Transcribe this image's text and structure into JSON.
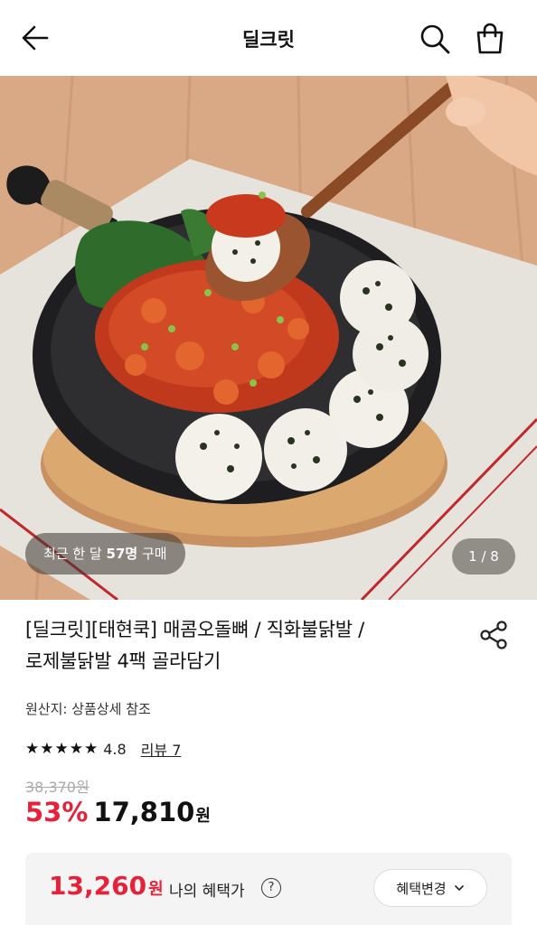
{
  "header": {
    "title": "딜크릿"
  },
  "gallery": {
    "purchase_prefix": "최근 한 달 ",
    "purchase_count": "57명",
    "purchase_suffix": " 구매",
    "page_indicator": "1 / 8"
  },
  "product": {
    "title_line1": "[딜크릿][태현쿡] 매콤오돌뼈 / 직화불닭발 /",
    "title_line2": "로제불닭발 4팩 골라담기",
    "origin": "원산지: 상품상세 참조",
    "rating_stars": 5,
    "rating_value": "4.8",
    "review_link": "리뷰 7",
    "original_price": "38,370원",
    "discount": "53%",
    "sale_price": "17,810",
    "sale_unit": "원"
  },
  "benefit": {
    "amount": "13,260",
    "unit": "원",
    "label": "나의 혜택가",
    "help_glyph": "?",
    "change_button": "혜택변경"
  },
  "icons": {
    "back": "back-arrow-icon",
    "search": "search-icon",
    "bag": "shopping-bag-icon",
    "share": "share-icon",
    "help": "question-circle-icon",
    "chevron": "chevron-down-icon"
  },
  "colors": {
    "accent_red": "#e5223a",
    "benefit_bg": "#f4f4f4"
  }
}
